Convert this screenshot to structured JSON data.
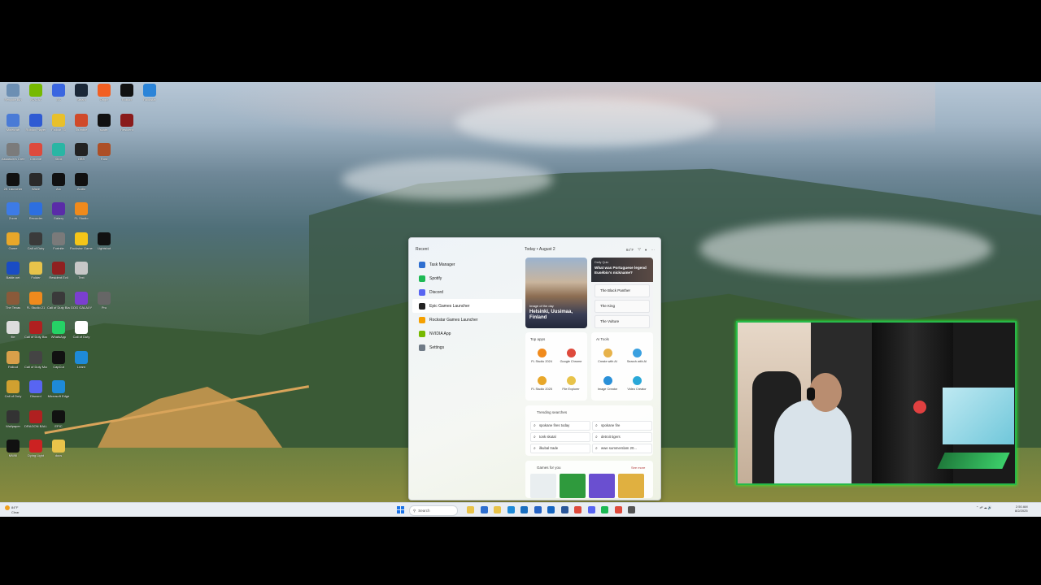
{
  "desktop_icons": [
    {
      "label": "Recycle Bin",
      "color": "#6c8fb3"
    },
    {
      "label": "NVIDIA",
      "color": "#76b900"
    },
    {
      "label": "EA",
      "color": "#3a66e0"
    },
    {
      "label": "Steam",
      "color": "#1b2838"
    },
    {
      "label": "Origin",
      "color": "#f25f22"
    },
    {
      "label": "Roblox",
      "color": "#111111"
    },
    {
      "label": "Rockstar",
      "color": "#2b84d8"
    },
    {
      "label": "Minecraft",
      "color": "#4a7bd6"
    },
    {
      "label": "Roblox Player",
      "color": "#2f5bd3"
    },
    {
      "label": "Fallout 76",
      "color": "#e8c02b"
    },
    {
      "label": "Stumble",
      "color": "#d04a2a"
    },
    {
      "label": "skate.",
      "color": "#111111"
    },
    {
      "label": "Resident",
      "color": "#8a1b1b"
    },
    {
      "label": "Assassin's Creed",
      "color": "#7b7b7b"
    },
    {
      "label": "Chrome",
      "color": "#de4a3c"
    },
    {
      "label": "Xbox",
      "color": "#29b6a4"
    },
    {
      "label": "OBS",
      "color": "#222222"
    },
    {
      "label": "Rust",
      "color": "#ad4f26"
    },
    {
      "label": "2K Launcher",
      "color": "#111111"
    },
    {
      "label": "Wave",
      "color": "#2a2a2a"
    },
    {
      "label": "Arc",
      "color": "#111111"
    },
    {
      "label": "Audio",
      "color": "#111111"
    },
    {
      "label": "Zoom",
      "color": "#3d7be6"
    },
    {
      "label": "Recorder",
      "color": "#2d6fe0"
    },
    {
      "label": "Galaxy",
      "color": "#5a2ca8"
    },
    {
      "label": "FL Studio",
      "color": "#f08a1c"
    },
    {
      "label": "Game",
      "color": "#e8a72a"
    },
    {
      "label": "Call of Duty",
      "color": "#3a3a3a"
    },
    {
      "label": "Fortnite",
      "color": "#7a7a7a"
    },
    {
      "label": "Rockstar Games",
      "color": "#f5c518"
    },
    {
      "label": "Lightshot",
      "color": "#111111"
    },
    {
      "label": "Battle.net",
      "color": "#1a4cc4"
    },
    {
      "label": "Folder",
      "color": "#e8c34a"
    },
    {
      "label": "Resident Evil",
      "color": "#8f2020"
    },
    {
      "label": "Text",
      "color": "#c7c7c7"
    },
    {
      "label": "The Texas",
      "color": "#8a5a3a"
    },
    {
      "label": "FL Studio 21",
      "color": "#f08a1c"
    },
    {
      "label": "Call of Duty Black Ops",
      "color": "#3a3a3a"
    },
    {
      "label": "GOG GALAXY",
      "color": "#7b3fd0"
    },
    {
      "label": "Pro",
      "color": "#666666"
    },
    {
      "label": "file",
      "color": "#dddddd"
    },
    {
      "label": "Call of Duty Black Ops",
      "color": "#b02020"
    },
    {
      "label": "WhatsApp",
      "color": "#25d366"
    },
    {
      "label": "Call of Duty",
      "color": "#ffffff"
    },
    {
      "label": "Fallout",
      "color": "#d8a04a"
    },
    {
      "label": "Call of Duty Modern",
      "color": "#444444"
    },
    {
      "label": "CapCut",
      "color": "#111111"
    },
    {
      "label": "Learn",
      "color": "#1e8ad8"
    },
    {
      "label": "Call of Duty",
      "color": "#d0a030"
    },
    {
      "label": "Discord",
      "color": "#5865f2"
    },
    {
      "label": "Microsoft Edge",
      "color": "#1e8ad8"
    },
    {
      "label": "Wallpaper",
      "color": "#333333"
    },
    {
      "label": "DRAGON BALL",
      "color": "#b02020"
    },
    {
      "label": "EPIC",
      "color": "#111111"
    },
    {
      "label": "MWIII",
      "color": "#111111"
    },
    {
      "label": "Dying Light",
      "color": "#cc2222"
    },
    {
      "label": "docs",
      "color": "#e8c34a"
    }
  ],
  "start_menu": {
    "recent_label": "Recent",
    "recent_items": [
      {
        "label": "Task Manager",
        "color": "#2f6fd0"
      },
      {
        "label": "Spotify",
        "color": "#1db954"
      },
      {
        "label": "Discord",
        "color": "#5865f2"
      },
      {
        "label": "Epic Games Launcher",
        "color": "#222222"
      },
      {
        "label": "Rockstar Games Launcher",
        "color": "#f5a000"
      },
      {
        "label": "NVIDIA App",
        "color": "#76b900"
      },
      {
        "label": "Settings",
        "color": "#6f7a86"
      }
    ],
    "today_label": "Today",
    "date_label": "August 2",
    "temp_label": "84°F",
    "image_card": {
      "kicker": "Image of the day",
      "title": "Helsinki, Uusimaa, Finland"
    },
    "quiz_card": {
      "kicker": "Daily Quiz",
      "question": "What was Portuguese legend Eusébio's nickname?",
      "options": [
        "The Black Panther",
        "The King",
        "The Vulture"
      ]
    },
    "top_apps": {
      "header": "Top apps",
      "apps": [
        {
          "label": "FL Studio 2024",
          "color": "#f08a1c"
        },
        {
          "label": "Google Chrome",
          "color": "#de4a3c"
        },
        {
          "label": "FL Studio 2025",
          "color": "#e8a72a"
        },
        {
          "label": "File Explorer",
          "color": "#e8c34a"
        }
      ]
    },
    "ai_tools": {
      "header": "AI Tools",
      "apps": [
        {
          "label": "Create with AI",
          "color": "#e7b24a"
        },
        {
          "label": "Search with AI",
          "color": "#3aa0e0"
        },
        {
          "label": "Image Creator",
          "color": "#2a90d8"
        },
        {
          "label": "Video Creator",
          "color": "#2aa8d8"
        }
      ]
    },
    "trending": {
      "header": "Trending searches",
      "items": [
        "spokane fires today",
        "spokane fire",
        "tonk skutal",
        "detroit tigers",
        "ilkubal trade",
        "wwe summerslam 20..."
      ]
    },
    "games": {
      "header": "Games for you",
      "see_more": "See more",
      "tiles": [
        {
          "color": "#e9eef0"
        },
        {
          "color": "#2f9a3d"
        },
        {
          "color": "#6a4fd0"
        },
        {
          "color": "#e0b040"
        }
      ]
    }
  },
  "taskbar": {
    "weather_temp": "84°F",
    "weather_desc": "Clear",
    "search_placeholder": "Search",
    "apps": [
      {
        "name": "file-explorer-icon",
        "color": "#e8c34a"
      },
      {
        "name": "store-icon",
        "color": "#2f6fd0"
      },
      {
        "name": "folder-icon",
        "color": "#e8c34a"
      },
      {
        "name": "photos-icon",
        "color": "#1e8ad8"
      },
      {
        "name": "settings-icon",
        "color": "#1a6fc0"
      },
      {
        "name": "calendar-icon",
        "color": "#2563c4"
      },
      {
        "name": "mail-icon",
        "color": "#1565c0"
      },
      {
        "name": "word-icon",
        "color": "#2b579a"
      },
      {
        "name": "chrome-icon",
        "color": "#de4a3c"
      },
      {
        "name": "discord-icon",
        "color": "#5865f2"
      },
      {
        "name": "spotify-icon",
        "color": "#1db954"
      },
      {
        "name": "chrome-icon-2",
        "color": "#de4a3c"
      },
      {
        "name": "settings-gear-icon",
        "color": "#555555"
      }
    ],
    "time": "2:50 AM",
    "date": "8/2/2025"
  }
}
